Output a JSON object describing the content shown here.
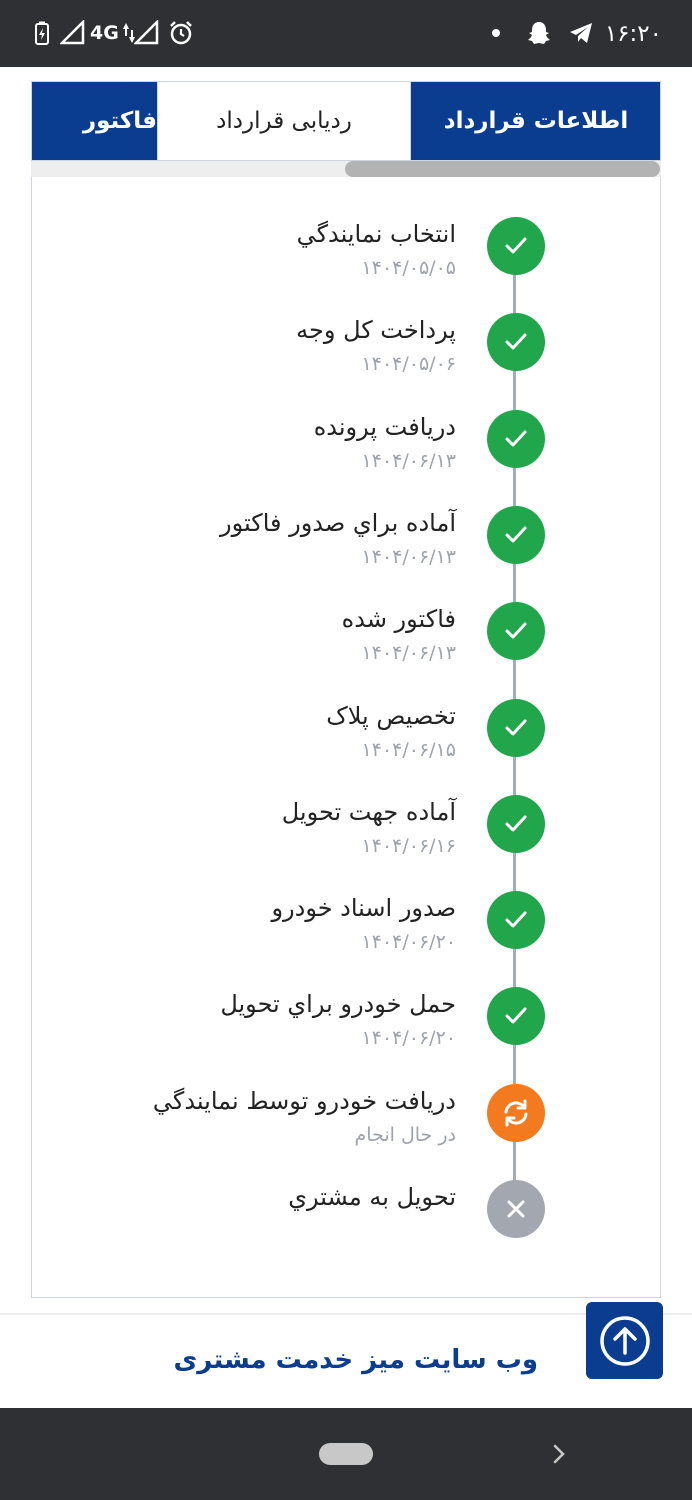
{
  "status_bar": {
    "time": "۱۶:۲۰",
    "network": "4G"
  },
  "tabs": [
    {
      "label": "اطلاعات قرارداد",
      "active": false
    },
    {
      "label": "ردیابی قرارداد",
      "active": true
    },
    {
      "label": "فاکتور",
      "active": false
    }
  ],
  "timeline": [
    {
      "title": "انتخاب نمايندگي",
      "subtitle": "۱۴۰۴/۰۵/۰۵",
      "status": "done"
    },
    {
      "title": "پرداخت کل وجه",
      "subtitle": "۱۴۰۴/۰۵/۰۶",
      "status": "done"
    },
    {
      "title": "دريافت پرونده",
      "subtitle": "۱۴۰۴/۰۶/۱۳",
      "status": "done"
    },
    {
      "title": "آماده براي صدور فاکتور",
      "subtitle": "۱۴۰۴/۰۶/۱۳",
      "status": "done"
    },
    {
      "title": "فاکتور شده",
      "subtitle": "۱۴۰۴/۰۶/۱۳",
      "status": "done"
    },
    {
      "title": "تخصيص پلاک",
      "subtitle": "۱۴۰۴/۰۶/۱۵",
      "status": "done"
    },
    {
      "title": "آماده جهت تحويل",
      "subtitle": "۱۴۰۴/۰۶/۱۶",
      "status": "done"
    },
    {
      "title": "صدور اسناد خودرو",
      "subtitle": "۱۴۰۴/۰۶/۲۰",
      "status": "done"
    },
    {
      "title": "حمل خودرو براي تحويل",
      "subtitle": "۱۴۰۴/۰۶/۲۰",
      "status": "done"
    },
    {
      "title": "دريافت خودرو توسط نمايندگي",
      "subtitle": "در حال انجام",
      "status": "in-progress"
    },
    {
      "title": "تحويل به مشتري",
      "subtitle": "",
      "status": "pending"
    }
  ],
  "footer": {
    "link_text": "وب سایت میز خدمت مشتری"
  },
  "colors": {
    "primary": "#0a3d8f",
    "done": "#22a64c",
    "in_progress": "#f47a1f",
    "pending": "#a3a7af"
  },
  "icons": {
    "done": "check-icon",
    "in_progress": "refresh-icon",
    "pending": "close-icon",
    "scroll_top": "arrow-up-circle-icon"
  }
}
